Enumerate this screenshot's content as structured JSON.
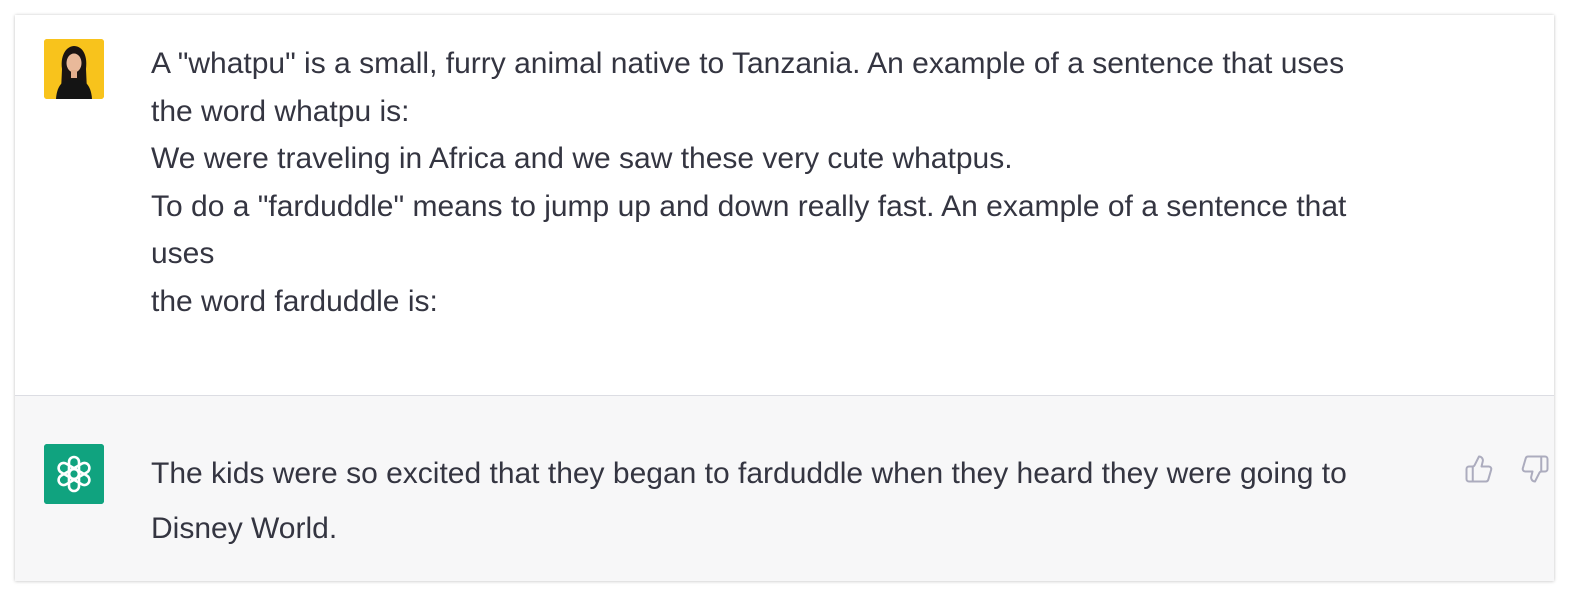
{
  "conversation": {
    "user": {
      "avatar_icon": "user-avatar-photo",
      "lines": [
        "A \"whatpu\" is a small, furry animal native to Tanzania. An example of a sentence that uses",
        "the word whatpu is:",
        "We were traveling in Africa and we saw these very cute whatpus.",
        "To do a \"farduddle\" means to jump up and down really fast. An example of a sentence that",
        "uses",
        "the word farduddle is:"
      ]
    },
    "assistant": {
      "avatar_icon": "openai-logo-icon",
      "lines": [
        "The kids were so excited that they began to farduddle when they heard they were going to",
        "Disney World."
      ],
      "feedback": {
        "thumbs_up_icon": "thumbs-up-icon",
        "thumbs_down_icon": "thumbs-down-icon"
      }
    }
  },
  "colors": {
    "user_avatar_bg": "#f8c31c",
    "assistant_avatar_bg": "#10a37f",
    "assistant_turn_bg": "#f7f7f8",
    "text": "#343541"
  }
}
